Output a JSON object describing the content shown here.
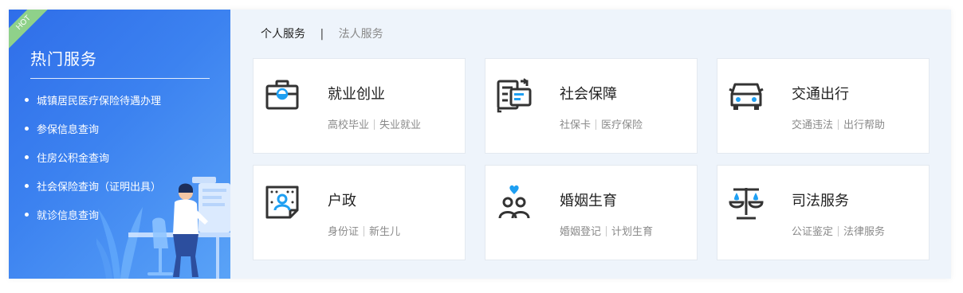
{
  "hot": {
    "badge": "HOT",
    "title": "热门服务",
    "items": [
      "城镇居民医疗保险待遇办理",
      "参保信息查询",
      "住房公积金查询",
      "社会保险查询（证明出具）",
      "就诊信息查询"
    ]
  },
  "tabs": [
    {
      "label": "个人服务",
      "active": true
    },
    {
      "label": "法人服务",
      "active": false
    }
  ],
  "cards": [
    {
      "title": "就业创业",
      "links": [
        "高校毕业",
        "失业就业"
      ],
      "icon": "briefcase-icon"
    },
    {
      "title": "社会保障",
      "links": [
        "社保卡",
        "医疗保险"
      ],
      "icon": "social-security-card-icon"
    },
    {
      "title": "交通出行",
      "links": [
        "交通违法",
        "出行帮助"
      ],
      "icon": "car-icon"
    },
    {
      "title": "户政",
      "links": [
        "身份证",
        "新生儿"
      ],
      "icon": "household-certificate-icon"
    },
    {
      "title": "婚姻生育",
      "links": [
        "婚姻登记",
        "计划生育"
      ],
      "icon": "couple-heart-icon"
    },
    {
      "title": "司法服务",
      "links": [
        "公证鉴定",
        "法律服务"
      ],
      "icon": "scales-icon"
    }
  ],
  "colors": {
    "accent": "#1e9ff2",
    "icon_dark": "#333333",
    "panel_blue": "#3c82f0",
    "ribbon_green": "#8fd18a"
  }
}
